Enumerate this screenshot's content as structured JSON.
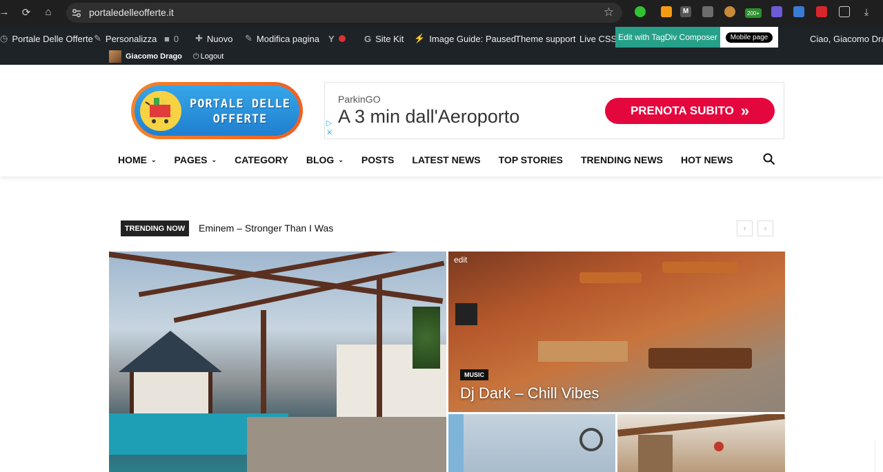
{
  "browser": {
    "url": "portaledelleofferte.it",
    "back_icon": "arrow-left-icon",
    "reload_icon": "reload-icon",
    "home_icon": "home-icon",
    "extensions": [
      "green-extension-icon",
      "orange-extension-icon",
      "m-extension-icon",
      "code-extension-icon",
      "cookie-extension-icon",
      "200-badge-icon",
      "link-extension-icon",
      "blue-extension-icon",
      "red-extension-icon",
      "puzzle-extension-icon",
      "download-icon"
    ],
    "badge_text": "200+"
  },
  "wp_admin": {
    "site": "Portale Delle Offerte",
    "customize": "Personalizza",
    "comments": "0",
    "new": "Nuovo",
    "edit_page": "Modifica pagina",
    "site_kit": "Site Kit",
    "image_guide": "Image Guide: Paused",
    "theme_support": "Theme support",
    "live_css": "Live CSS",
    "tagdiv": "Edit with TagDiv Composer",
    "mobile": "Mobile page",
    "greeting": "Ciao, Giacomo Drag",
    "user_name": "Giacomo Drago",
    "logout": "Logout",
    "colors": {
      "bar": "#1d2327",
      "tagdiv": "#27a08a"
    }
  },
  "logo": {
    "line1": "PORTALE DELLE",
    "line2": "OFFERTE"
  },
  "ad": {
    "brand": "ParkinGO",
    "title": "A 3 min dall'Aeroporto",
    "cta": "PRENOTA SUBITO",
    "cta_arrows": "»",
    "color": "#e4073d"
  },
  "nav": {
    "items": [
      {
        "label": "HOME",
        "dropdown": true
      },
      {
        "label": "PAGES",
        "dropdown": true
      },
      {
        "label": "CATEGORY",
        "dropdown": false
      },
      {
        "label": "BLOG",
        "dropdown": true
      },
      {
        "label": "POSTS",
        "dropdown": false
      },
      {
        "label": "LATEST NEWS",
        "dropdown": false
      },
      {
        "label": "TOP STORIES",
        "dropdown": false
      },
      {
        "label": "TRENDING NEWS",
        "dropdown": false
      },
      {
        "label": "HOT NEWS",
        "dropdown": false
      }
    ],
    "search_icon": "search-icon"
  },
  "trending": {
    "label": "TRENDING NOW",
    "text": "Eminem – Stronger Than I Was",
    "prev": "‹",
    "next": "›"
  },
  "featured": {
    "edit_label": "edit",
    "category": "MUSIC",
    "title": "Dj Dark – Chill Vibes"
  }
}
